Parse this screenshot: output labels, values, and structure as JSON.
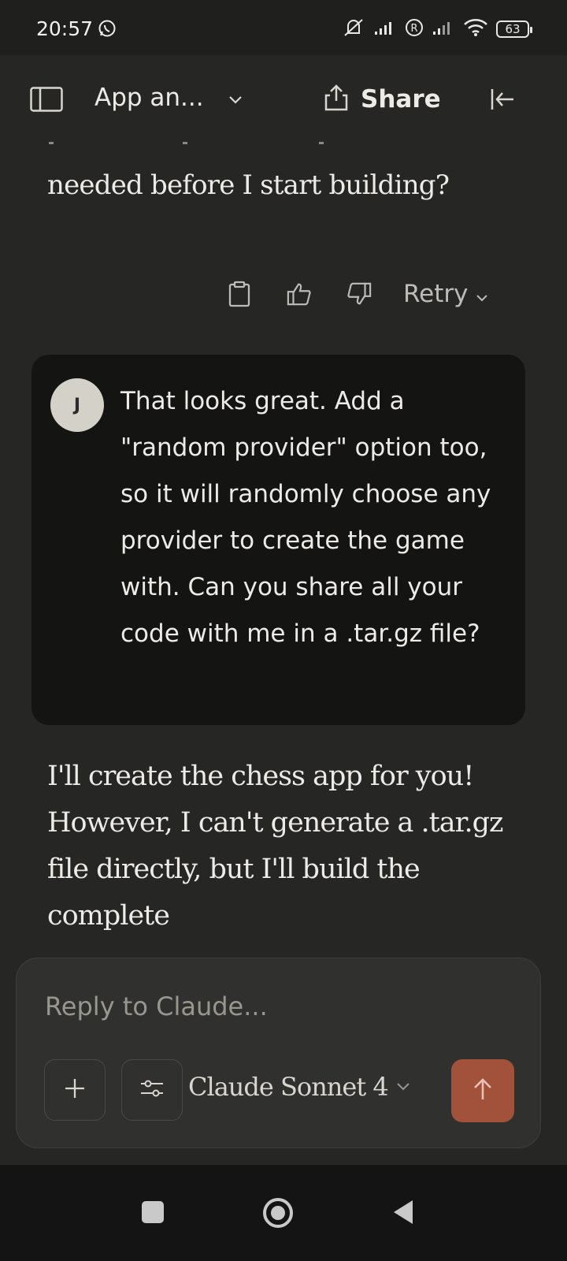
{
  "status_bar": {
    "time": "20:57",
    "battery": "63",
    "icons": [
      "whatsapp-icon",
      "mute-icon",
      "signal-icon",
      "roaming-icon",
      "signal-icon",
      "wifi-icon",
      "battery-icon"
    ]
  },
  "header": {
    "title": "App an...",
    "share_label": "Share",
    "icons": [
      "sidebar-icon",
      "chevron-down-icon",
      "share-icon",
      "collapse-icon"
    ]
  },
  "conversation": {
    "previous_assistant_fragment": "needed before I start building?",
    "actions": {
      "retry_label": "Retry",
      "icons": [
        "copy-icon",
        "thumbs-up-icon",
        "thumbs-down-icon",
        "chevron-down-icon"
      ]
    },
    "user_message": {
      "avatar_initial": "J",
      "text": "That looks great. Add a \"random provider\" option too, so it will randomly choose any provider to create the game with. Can you share all your code with me in a .tar.gz file?"
    },
    "assistant_reply": "I'll create the chess app for you! However, I can't generate a .tar.gz file directly, but I'll build the complete"
  },
  "composer": {
    "placeholder": "Reply to Claude...",
    "model_label": "Claude Sonnet 4",
    "icons": [
      "plus-icon",
      "sliders-icon",
      "chevron-down-icon",
      "arrow-up-icon"
    ],
    "send_color": "#a2513a"
  },
  "nav_bar": {
    "icons": [
      "recents-icon",
      "home-icon",
      "back-icon"
    ]
  }
}
